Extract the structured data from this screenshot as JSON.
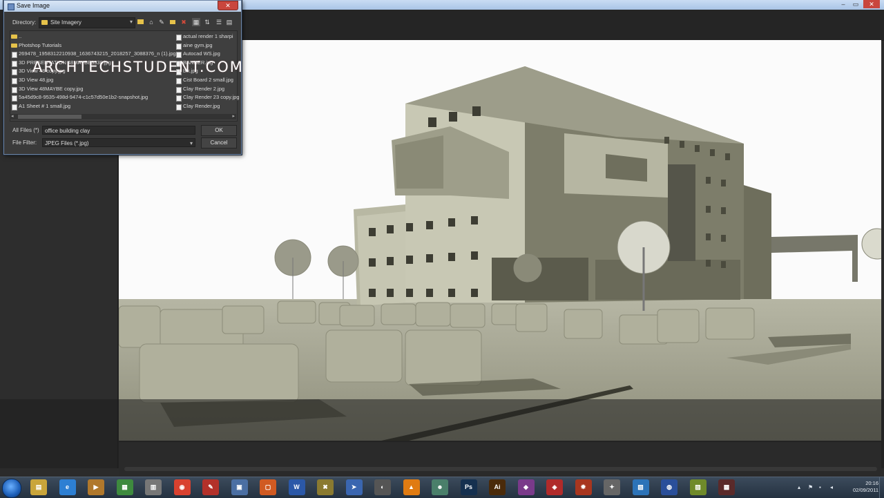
{
  "dialog": {
    "title": "Save Image",
    "close_glyph": "✕",
    "directory_label": "Directory:",
    "directory_value": "Site Imagery",
    "toolbar_icons": [
      "folder-up-icon",
      "home-icon",
      "favorites-icon",
      "new-folder-icon",
      "delete-icon",
      "grid-view-icon",
      "sort-icon",
      "list-view-icon",
      "details-view-icon"
    ],
    "files_col1": [
      {
        "name": "..",
        "type": "folder"
      },
      {
        "name": "Photshop Tutorials",
        "type": "folder"
      },
      {
        "name": "269478_1958312210938_1636743215_2018257_3088376_n (1).jpg",
        "type": "file"
      },
      {
        "name": "3D PRESENTATION 48MAYBE3338.jpg",
        "type": "file"
      },
      {
        "name": "3D View 48 copy.jpg",
        "type": "file"
      },
      {
        "name": "3D View 48.jpg",
        "type": "file"
      },
      {
        "name": "3D View 48MAYBE copy.jpg",
        "type": "file"
      },
      {
        "name": "5a45d9c8-9535-498d-9474-c1c57d50e1b2-snapshot.jpg",
        "type": "file"
      },
      {
        "name": "A1 Sheet # 1 small.jpg",
        "type": "file"
      }
    ],
    "files_col2": [
      {
        "name": "actual render 1 sharpi",
        "type": "file"
      },
      {
        "name": "aine gym.jpg",
        "type": "file"
      },
      {
        "name": "Autocad WS.jpg",
        "type": "file"
      },
      {
        "name": "BANNER.jpg",
        "type": "file"
      },
      {
        "name": "blk.jpg",
        "type": "file"
      },
      {
        "name": "Cist Board 2 small.jpg",
        "type": "file"
      },
      {
        "name": "Clay Render 2.jpg",
        "type": "file"
      },
      {
        "name": "Clay Render 23 copy.jpg",
        "type": "file"
      },
      {
        "name": "Clay Render.jpg",
        "type": "file"
      }
    ],
    "scroll_left": "◂",
    "scroll_right": "▸",
    "filename_label": "All Files (*)",
    "filename_value": "office building clay",
    "filter_label": "File Filter:",
    "filter_value": "JPEG Files (*.jpg)",
    "ok_label": "OK",
    "cancel_label": "Cancel"
  },
  "watermark": "ARCHTECHSTUDENT.COM",
  "window_controls": [
    "–",
    "▭",
    "✕"
  ],
  "taskbar": {
    "apps": [
      {
        "name": "explorer",
        "glyph": "▤",
        "color": "#c9a53b"
      },
      {
        "name": "internet-explorer",
        "glyph": "e",
        "color": "#2d7fd3"
      },
      {
        "name": "media",
        "glyph": "▶",
        "color": "#b0782c"
      },
      {
        "name": "app-green",
        "glyph": "▦",
        "color": "#3e8a3e"
      },
      {
        "name": "app-gray",
        "glyph": "▥",
        "color": "#777777"
      },
      {
        "name": "chrome",
        "glyph": "◉",
        "color": "#d9412f"
      },
      {
        "name": "sketchup",
        "glyph": "✎",
        "color": "#b3312a"
      },
      {
        "name": "app-blue",
        "glyph": "▣",
        "color": "#4b6fa3"
      },
      {
        "name": "app-orange",
        "glyph": "▢",
        "color": "#d05a22"
      },
      {
        "name": "word",
        "glyph": "W",
        "color": "#2b58a8"
      },
      {
        "name": "app-x",
        "glyph": "✖",
        "color": "#8a7a30"
      },
      {
        "name": "app-arrow",
        "glyph": "➤",
        "color": "#3a66b0"
      },
      {
        "name": "app-steam",
        "glyph": "◐",
        "color": "#555555"
      },
      {
        "name": "vlc",
        "glyph": "▲",
        "color": "#e07b12"
      },
      {
        "name": "app-people",
        "glyph": "☻",
        "color": "#4a7f6a"
      },
      {
        "name": "photoshop",
        "glyph": "Ps",
        "color": "#15304f"
      },
      {
        "name": "illustrator",
        "glyph": "Ai",
        "color": "#4a2a0a"
      },
      {
        "name": "app-purple",
        "glyph": "◆",
        "color": "#7a3a8a"
      },
      {
        "name": "app-red",
        "glyph": "◈",
        "color": "#b02a2a"
      },
      {
        "name": "app-fire",
        "glyph": "✹",
        "color": "#a8361f"
      },
      {
        "name": "app-dark",
        "glyph": "✦",
        "color": "#666666"
      },
      {
        "name": "app-cyan",
        "glyph": "▧",
        "color": "#2c73b8"
      },
      {
        "name": "app-globe",
        "glyph": "◍",
        "color": "#2a4f9a"
      },
      {
        "name": "app-notes",
        "glyph": "▨",
        "color": "#6f8a2a"
      },
      {
        "name": "app-render",
        "glyph": "▩",
        "color": "#5a2a2a"
      }
    ],
    "time": "20:16",
    "date": "02/09/2011"
  }
}
